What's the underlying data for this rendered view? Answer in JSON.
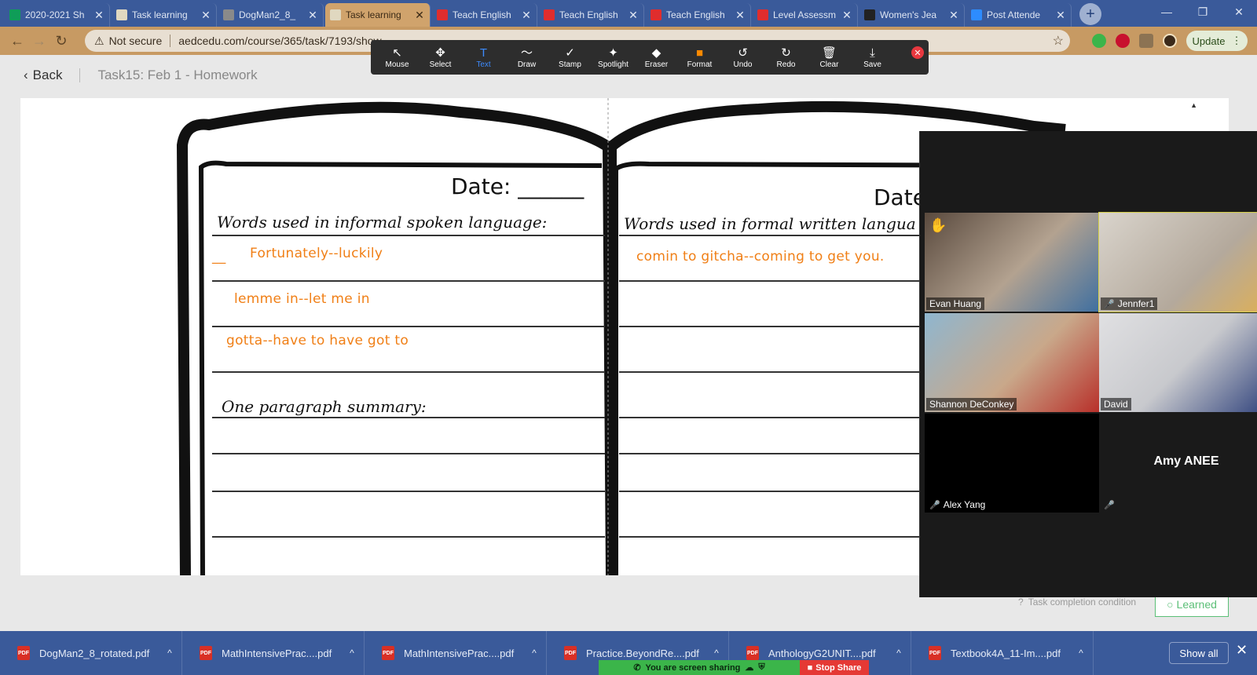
{
  "browser": {
    "tabs": [
      {
        "title": "2020-2021 Sh",
        "icon": "sheets-icon",
        "color": "#0f9d58"
      },
      {
        "title": "Task learning",
        "icon": "site-icon",
        "color": "#e0d8c0"
      },
      {
        "title": "DogMan2_8_",
        "icon": "globe-icon",
        "color": "#8a8a8a"
      },
      {
        "title": "Task learning",
        "icon": "site-icon",
        "color": "#e0d8c0",
        "active": true
      },
      {
        "title": "Teach English",
        "icon": "teach-icon",
        "color": "#e02d2d"
      },
      {
        "title": "Teach English",
        "icon": "teach-icon",
        "color": "#e02d2d"
      },
      {
        "title": "Teach English",
        "icon": "teach-icon",
        "color": "#e02d2d"
      },
      {
        "title": "Level Assessm",
        "icon": "teach-icon",
        "color": "#e02d2d"
      },
      {
        "title": "Women's Jea",
        "icon": "ae-icon",
        "color": "#222222"
      },
      {
        "title": "Post Attende",
        "icon": "zoom-icon",
        "color": "#2d8cff"
      }
    ],
    "new_tab": "+",
    "security_label": "Not secure",
    "url": "aedcedu.com/course/365/task/7193/show",
    "update_label": "Update"
  },
  "zoom_toolbar": {
    "tools": [
      {
        "label": "Mouse",
        "icon": "↖"
      },
      {
        "label": "Select",
        "icon": "✥"
      },
      {
        "label": "Text",
        "icon": "T",
        "selected": true
      },
      {
        "label": "Draw",
        "icon": "〜"
      },
      {
        "label": "Stamp",
        "icon": "✓"
      },
      {
        "label": "Spotlight",
        "icon": "✦"
      },
      {
        "label": "Eraser",
        "icon": "◆"
      },
      {
        "label": "Format",
        "icon": "■"
      },
      {
        "label": "Undo",
        "icon": "↺"
      },
      {
        "label": "Redo",
        "icon": "↻"
      },
      {
        "label": "Clear",
        "icon": "🗑"
      },
      {
        "label": "Save",
        "icon": "⤓"
      }
    ],
    "format_color": "#ff8a00"
  },
  "page": {
    "back_label": "Back",
    "task_title": "Task15:  Feb 1 - Homework",
    "completion_condition": "Task completion condition",
    "learned_label": "Learned"
  },
  "worksheet": {
    "left_date": "Date: ______",
    "right_date": "Date",
    "left_heading": "Words used in informal spoken language:",
    "right_heading": "Words used in formal written langua",
    "summary_heading": "One paragraph summary:",
    "answers_left": [
      "Fortunately--luckily",
      "lemme in--let me in",
      "gotta--have to  have got to"
    ],
    "answers_right": [
      "comin to gitcha--coming to get you."
    ],
    "annotation_color": "#f07f16"
  },
  "zoom_gallery": {
    "participants": [
      {
        "name": "Evan Huang",
        "muted": false,
        "raised_hand": true
      },
      {
        "name": "Jennfer1",
        "muted": true,
        "talking": true
      },
      {
        "name": "Shannon DeConkey",
        "muted": false
      },
      {
        "name": "David",
        "muted": false
      },
      {
        "name": "Alex Yang",
        "muted": true
      },
      {
        "name": "Amy ANEE",
        "muted": true,
        "video_off": true
      }
    ]
  },
  "downloads": {
    "items": [
      "DogMan2_8_rotated.pdf",
      "MathIntensivePrac....pdf",
      "MathIntensivePrac....pdf",
      "Practice.BeyondRe....pdf",
      "AnthologyG2UNIT....pdf",
      "Textbook4A_11-Im....pdf"
    ],
    "show_all": "Show all"
  },
  "share_bar": {
    "status": "You are screen sharing",
    "stop": "Stop Share"
  }
}
